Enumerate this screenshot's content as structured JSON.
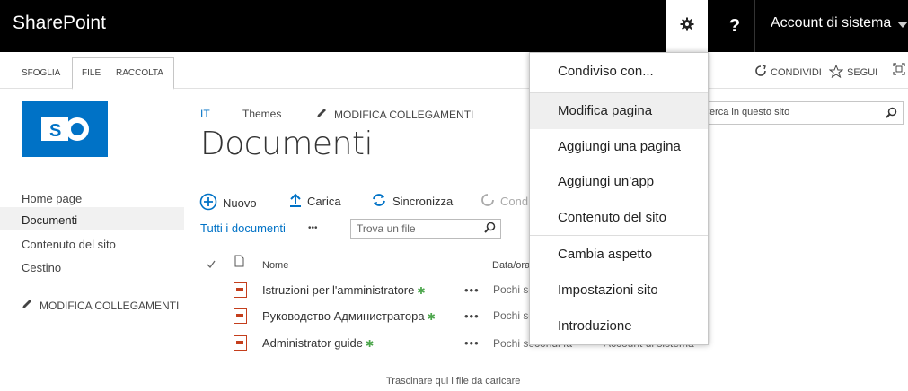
{
  "suitebar": {
    "brand": "SharePoint",
    "help": "?",
    "account": "Account di sistema"
  },
  "ribbon": {
    "tabs": [
      "SFOGLIA",
      "FILE",
      "RACCOLTA"
    ],
    "share": "CONDIVIDI",
    "follow": "SEGUI"
  },
  "leftnav": {
    "items": [
      "Home page",
      "Documenti",
      "Contenuto del sito",
      "Cestino"
    ],
    "edit_links": "MODIFICA COLLEGAMENTI"
  },
  "breadcrumb": {
    "items": [
      "IT",
      "Themes"
    ],
    "edit_links": "MODIFICA COLLEGAMENTI"
  },
  "page": {
    "title": "Documenti"
  },
  "commands": {
    "new": "Nuovo",
    "upload": "Carica",
    "sync": "Sincronizza",
    "share": "Cond"
  },
  "views": {
    "current": "Tutti i documenti",
    "more": "•••",
    "find_placeholder": "Trova un file"
  },
  "table": {
    "headers": {
      "name": "Nome",
      "date": "Data/ora"
    },
    "rows": [
      {
        "name": "Istruzioni per l'amministratore",
        "new": "✱",
        "dots": "•••",
        "date": "Pochi se"
      },
      {
        "name": "Руководство Администратора",
        "new": "✱",
        "dots": "•••",
        "date": "Pochi se"
      },
      {
        "name": "Administrator guide",
        "new": "✱",
        "dots": "•••",
        "date": "Pochi secondi fa",
        "modified_by": "Account di sistema"
      }
    ]
  },
  "dropzone": "Trascinare qui i file da caricare",
  "search": {
    "placeholder": "Cerca in questo sito"
  },
  "settings_menu": {
    "items": [
      "Condiviso con...",
      "Modifica pagina",
      "Aggiungi una pagina",
      "Aggiungi un'app",
      "Contenuto del sito",
      "Cambia aspetto",
      "Impostazioni sito",
      "Introduzione"
    ]
  },
  "colors": {
    "accent": "#0072c6",
    "suitebar": "#000000",
    "new_marker": "#4ca64c"
  }
}
